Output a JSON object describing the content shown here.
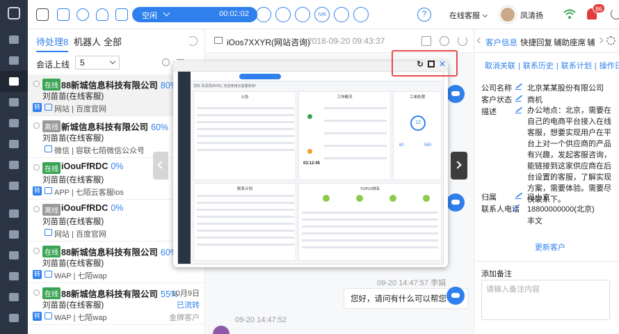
{
  "topbar": {
    "status": "空闲",
    "timer": "00:02:02",
    "controls": [
      "hold",
      "mute",
      "transfer",
      "pause",
      "ivr",
      "consult",
      "end"
    ],
    "ivr_label": "IVR",
    "help": "?",
    "agent_status": "在线客服",
    "user_name": "凤清扬",
    "notification_count": "86"
  },
  "list": {
    "tabs": [
      "待处理8",
      "机器人",
      "全部"
    ],
    "limit_label": "会话上线",
    "limit_value": "5",
    "sessions": [
      {
        "tag": "在线",
        "company": "88新城信息科技有限公司",
        "pct": "80%",
        "agent": "刘苗苗(在线客服)",
        "badge": "转",
        "source": "网站 | 百度官网",
        "date": "",
        "status": "",
        "level": ""
      },
      {
        "tag": "离线",
        "company": "新城信息科技有限公司",
        "pct": "60%",
        "agent": "刘苗苗(在线客服)",
        "badge": "",
        "source": "微信 | 容联七陌微信公众号",
        "date": "",
        "status": "",
        "level": ""
      },
      {
        "tag": "在线",
        "company": "iOouFfRDC",
        "pct": "0%",
        "agent": "刘苗苗(在线客服)",
        "badge": "转",
        "source": "APP | 七陌云客服ios",
        "date": "",
        "status": "",
        "level": ""
      },
      {
        "tag": "离线",
        "company": "iOouFfRDC",
        "pct": "0%",
        "agent": "刘苗苗(在线客服)",
        "badge": "",
        "source": "网站 | 百度官网",
        "date": "",
        "status": "",
        "level": ""
      },
      {
        "tag": "在线",
        "company": "88新城信息科技有限公司",
        "pct": "60%",
        "agent": "刘苗苗(在线客服)",
        "badge": "转",
        "source": "WAP | 七陌wap",
        "date": "",
        "status": "",
        "level": ""
      },
      {
        "tag": "在线",
        "company": "88新城信息科技有限公司",
        "pct": "55%",
        "agent": "刘苗苗(在线客服)",
        "badge": "转",
        "source": "WAP | 七陌wap",
        "date": "10月9日",
        "status": "已流转",
        "level": "金牌客户"
      }
    ]
  },
  "chat": {
    "title": "iOos7XXYR(网站咨询)",
    "time": "2018-09-20 09:43:37",
    "messages": [
      {
        "time": "09-20 14:47:57 李娟",
        "text": "您好，请问有什么可以帮您? 😊"
      },
      {
        "time": "09-20 14:47:52",
        "text": ""
      }
    ]
  },
  "preview": {
    "welcome": "您好 凤清扬(8035), 欢迎使用云客服系统!",
    "cards": [
      "公告",
      "工作概况",
      "工单处理",
      "联系计划",
      "TOP10排名"
    ],
    "ticket_count": "12",
    "ticket_label": "待处理",
    "ticket_stats": [
      "60",
      "560"
    ],
    "call_time": "03:12:45"
  },
  "right": {
    "tabs": [
      "客户信息",
      "快捷回复",
      "辅助座席",
      "辅"
    ],
    "links": [
      "取消关联",
      "联系历史",
      "联系计划",
      "操作日志"
    ],
    "fields": [
      {
        "k": "公司名称",
        "v": "北京某某股份有限公司"
      },
      {
        "k": "客户状态",
        "v": "商机"
      },
      {
        "k": "描述",
        "v": ""
      }
    ],
    "description": "办公地点：北京，需要在自己的电商平台接入在线客服，想要实现用户在平台上对一个供应商的产品有兴趣，发起客服咨询，能链接到这家供应商在后台设置的客服，了解实现方案，需要体验。需要尽快联系下。",
    "owner": {
      "k": "归属",
      "v": "冯小京"
    },
    "phone": {
      "k": "联系人电话",
      "v": "18800000000(北京)"
    },
    "extra": "丰文",
    "more": "更新客户",
    "note_title": "添加备注",
    "note_placeholder": "请输入备注内容"
  }
}
